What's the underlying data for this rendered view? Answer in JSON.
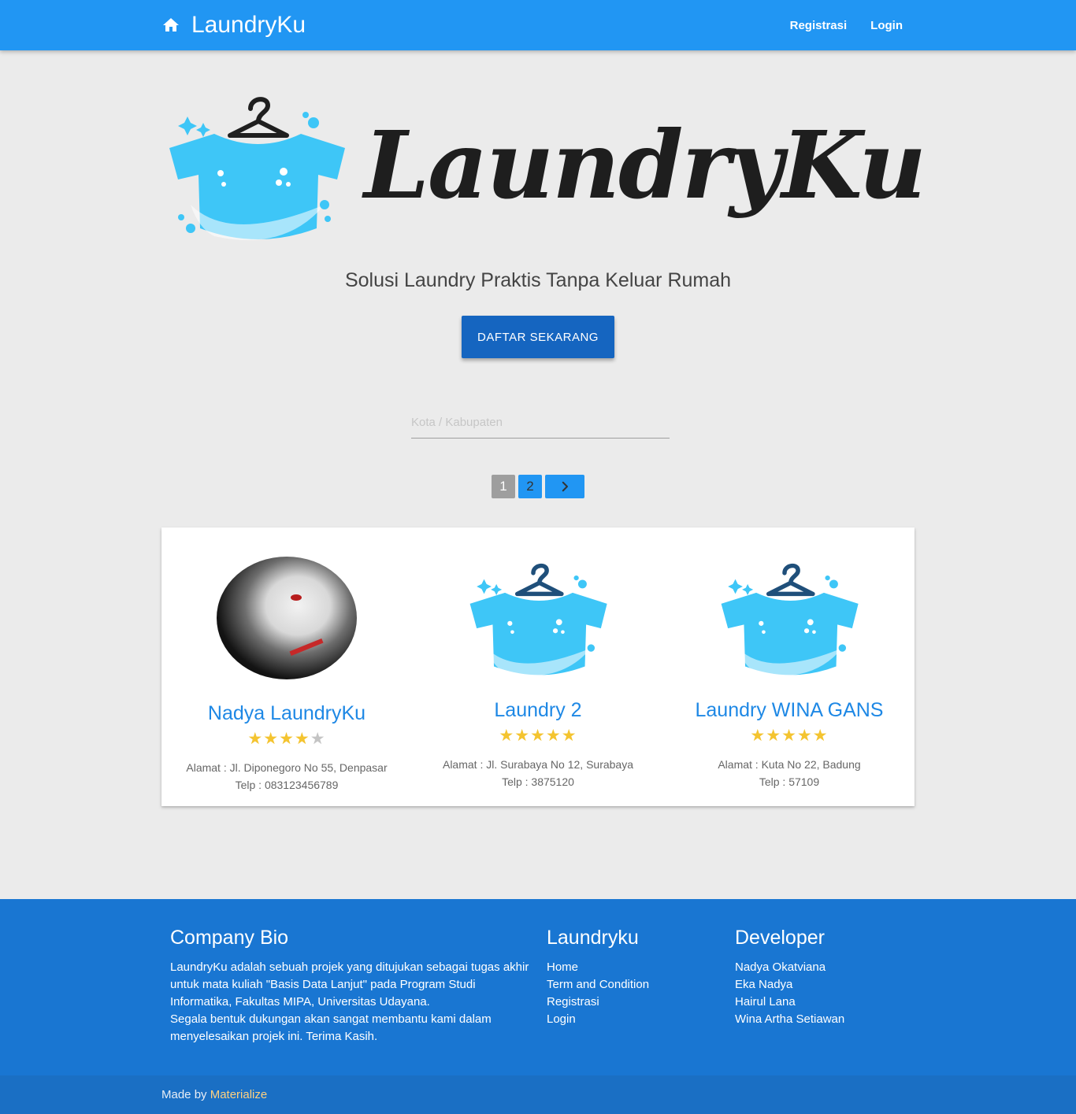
{
  "nav": {
    "brand": "LaundryKu",
    "links": [
      "Registrasi",
      "Login"
    ]
  },
  "hero": {
    "logo_text": "LaundryKu",
    "tagline": "Solusi Laundry Praktis Tanpa Keluar Rumah",
    "cta_label": "DAFTAR SEKARANG"
  },
  "search": {
    "placeholder": "Kota / Kabupaten",
    "value": ""
  },
  "pagination": {
    "pages": [
      "1",
      "2"
    ],
    "current": 1,
    "next_icon": "chevron-right-icon"
  },
  "laundries": [
    {
      "name": "Nadya LaundryKu",
      "rating": 4,
      "max_rating": 5,
      "address": "Alamat : Jl. Diponegoro No 55, Denpasar",
      "phone": "Telp : 083123456789",
      "image": "avatar-photo"
    },
    {
      "name": "Laundry 2",
      "rating": 5,
      "max_rating": 5,
      "address": "Alamat : Jl. Surabaya No 12, Surabaya",
      "phone": "Telp : 3875120",
      "image": "laundry-logo"
    },
    {
      "name": "Laundry WINA GANS",
      "rating": 5,
      "max_rating": 5,
      "address": "Alamat : Kuta No 22, Badung",
      "phone": "Telp : 57109",
      "image": "laundry-logo"
    }
  ],
  "footer": {
    "bio": {
      "title": "Company Bio",
      "text1": "LaundryKu adalah sebuah projek yang ditujukan sebagai tugas akhir untuk mata kuliah \"Basis Data Lanjut\" pada Program Studi Informatika, Fakultas MIPA, Universitas Udayana.",
      "text2": "Segala bentuk dukungan akan sangat membantu kami dalam menyelesaikan projek ini. Terima Kasih."
    },
    "links": {
      "title": "Laundryku",
      "items": [
        "Home",
        "Term and Condition",
        "Registrasi",
        "Login"
      ]
    },
    "developer": {
      "title": "Developer",
      "items": [
        "Nadya Okatviana",
        "Eka Nadya",
        "Hairul Lana",
        "Wina Artha Setiawan"
      ]
    },
    "made_by_prefix": "Made by ",
    "made_by_link": "Materialize"
  },
  "colors": {
    "primary": "#2196f3",
    "cta": "#1565c0",
    "footer": "#1976d2",
    "star": "#f4c430",
    "name_link": "#1e88e5"
  }
}
